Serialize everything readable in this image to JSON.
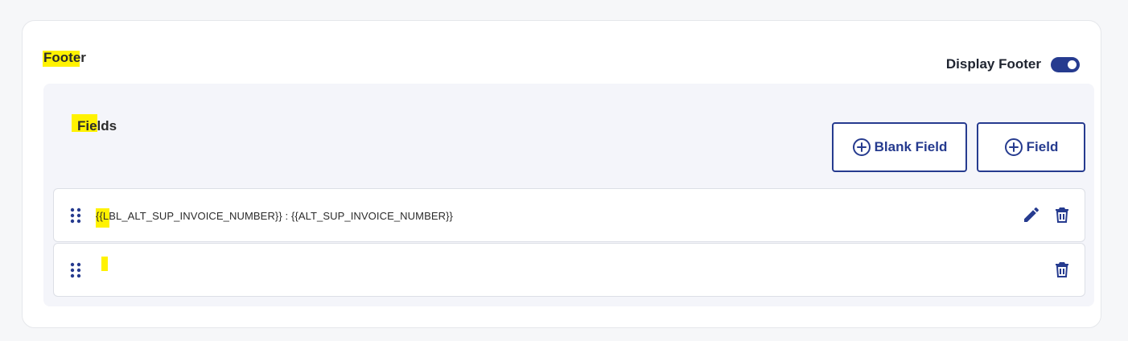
{
  "footer": {
    "title": "Footer",
    "display_toggle": {
      "label": "Display Footer",
      "enabled": true
    }
  },
  "fields": {
    "title": "Fields",
    "buttons": {
      "blank_field": "Blank Field",
      "field": "Field"
    },
    "rows": [
      {
        "text": "{{LBL_ALT_SUP_INVOICE_NUMBER}} : {{ALT_SUP_INVOICE_NUMBER}}",
        "editable": true
      },
      {
        "text": "",
        "editable": false
      }
    ]
  },
  "colors": {
    "accent": "#263b8f",
    "highlight": "#fff200",
    "panel_bg": "#f4f5fa"
  },
  "icons": {
    "drag": "drag-dots-icon",
    "add": "plus-circle-icon",
    "edit": "pencil-icon",
    "delete": "trash-icon"
  }
}
